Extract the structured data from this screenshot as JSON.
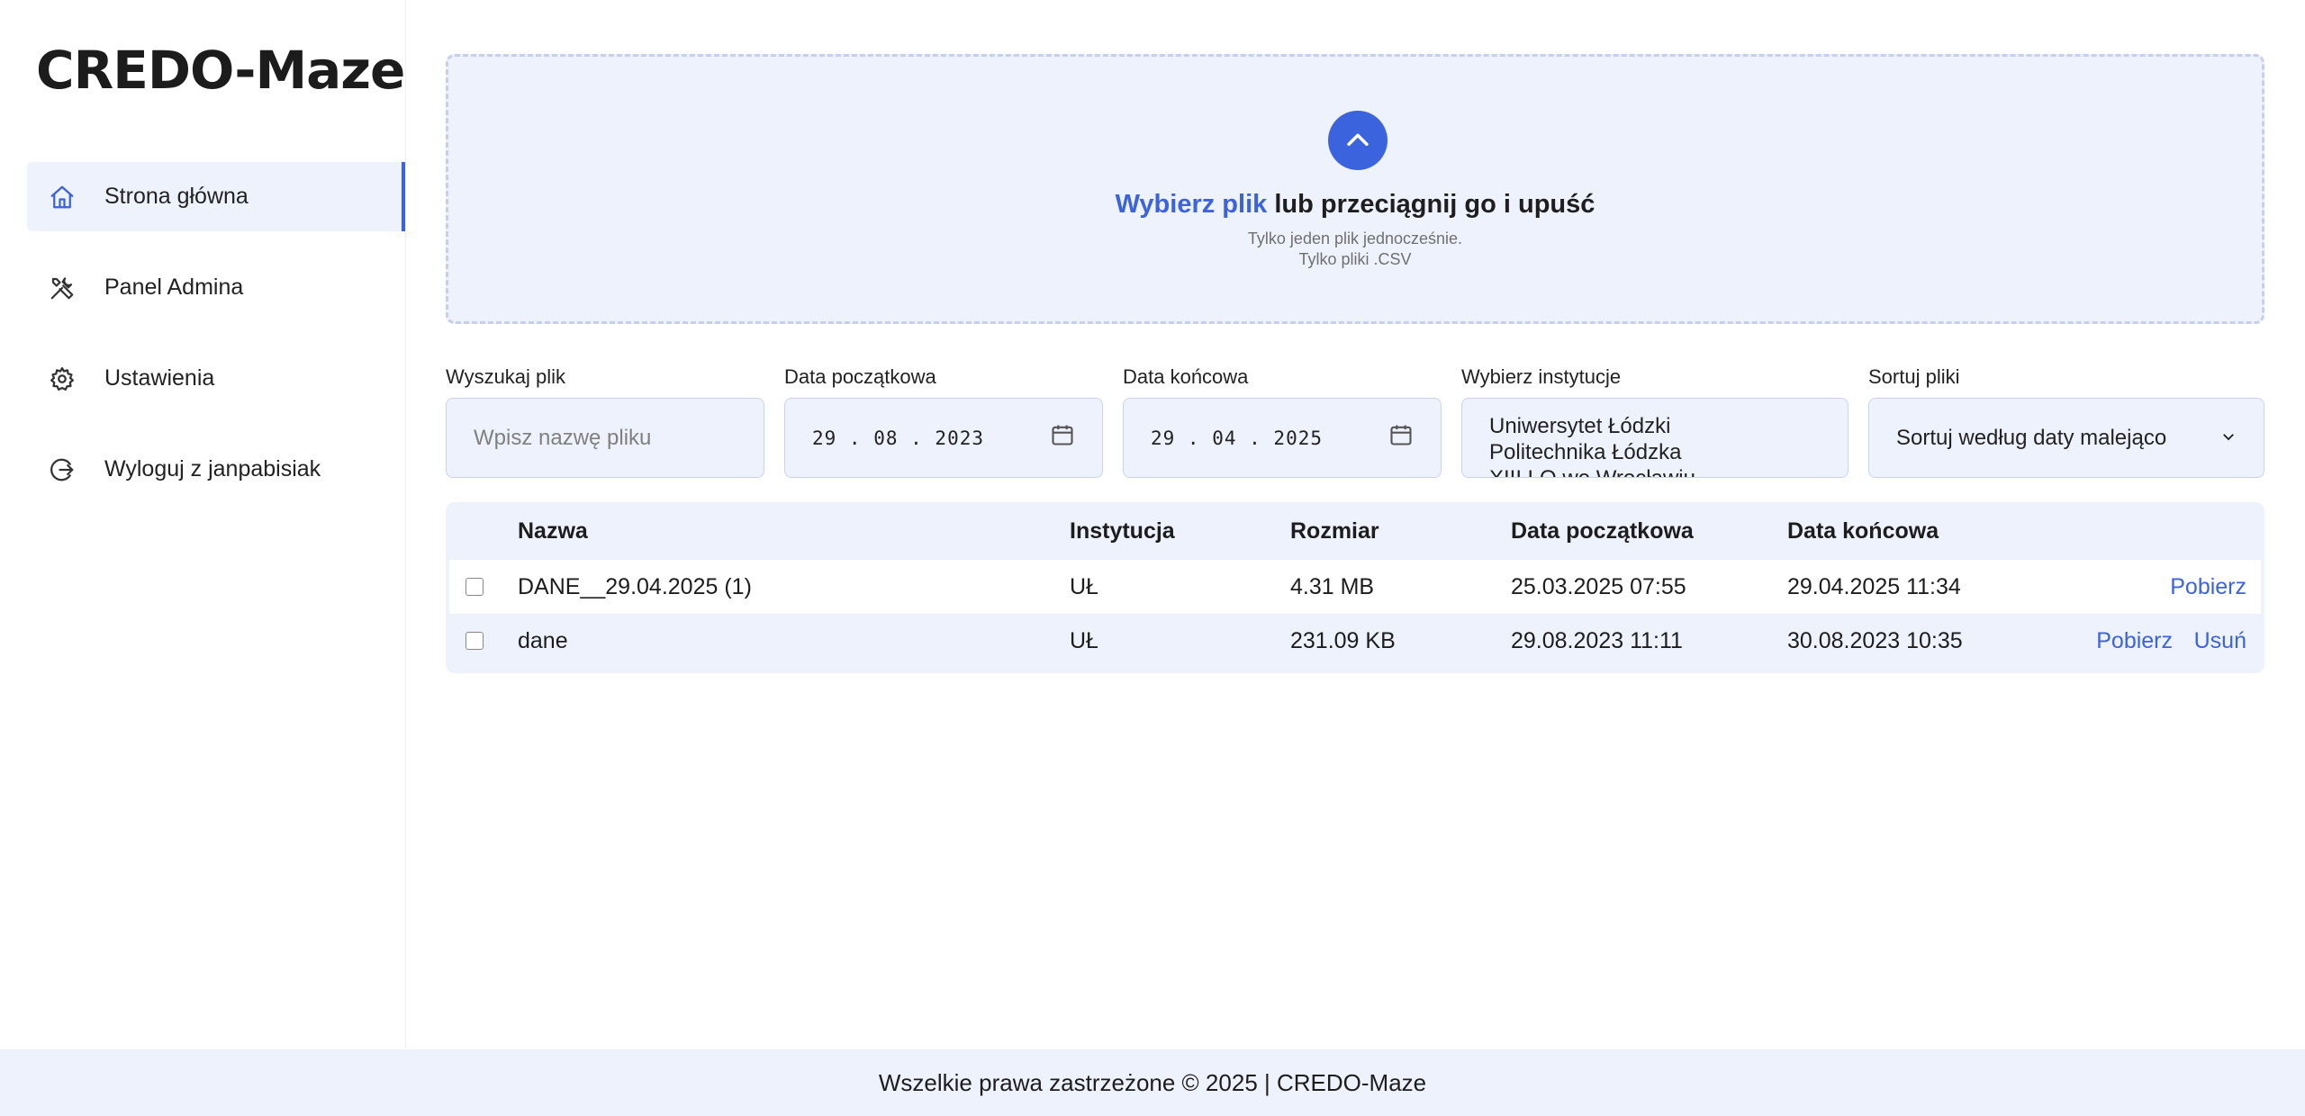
{
  "app": {
    "logo": "CREDO-Maze"
  },
  "sidebar": {
    "items": [
      {
        "label": "Strona główna",
        "icon": "home-icon",
        "active": true
      },
      {
        "label": "Panel Admina",
        "icon": "tools-icon",
        "active": false
      },
      {
        "label": "Ustawienia",
        "icon": "gear-icon",
        "active": false
      },
      {
        "label": "Wyloguj z janpabisiak",
        "icon": "logout-icon",
        "active": false
      }
    ]
  },
  "upload": {
    "link_text": "Wybierz plik",
    "title_rest": " lub przeciągnij go i upuść",
    "line1": "Tylko jeden plik jednocześnie.",
    "line2": "Tylko pliki .CSV"
  },
  "filters": {
    "search": {
      "label": "Wyszukaj plik",
      "placeholder": "Wpisz nazwę pliku"
    },
    "start_date": {
      "label": "Data początkowa",
      "value": "29 . 08 . 2023"
    },
    "end_date": {
      "label": "Data końcowa",
      "value": "29 . 04 . 2025"
    },
    "institution": {
      "label": "Wybierz instytucje",
      "options": [
        "Uniwersytet Łódzki",
        "Politechnika Łódzka",
        "XIII LO we Wrocławiu"
      ]
    },
    "sort": {
      "label": "Sortuj pliki",
      "value": "Sortuj według daty malejąco"
    }
  },
  "table": {
    "headers": [
      "Nazwa",
      "Instytucja",
      "Rozmiar",
      "Data początkowa",
      "Data końcowa"
    ],
    "rows": [
      {
        "name": "DANE__29.04.2025 (1)",
        "institution": "UŁ",
        "size": "4.31 MB",
        "start": "25.03.2025 07:55",
        "end": "29.04.2025 11:34",
        "actions": [
          "Pobierz"
        ]
      },
      {
        "name": "dane",
        "institution": "UŁ",
        "size": "231.09 KB",
        "start": "29.08.2023 11:11",
        "end": "30.08.2023 10:35",
        "actions": [
          "Pobierz",
          "Usuń"
        ]
      }
    ]
  },
  "footer": {
    "text": "Wszelkie prawa zastrzeżone © 2025 | CREDO-Maze"
  },
  "colors": {
    "accent": "#3b63dd",
    "panel": "#eef2fd"
  }
}
